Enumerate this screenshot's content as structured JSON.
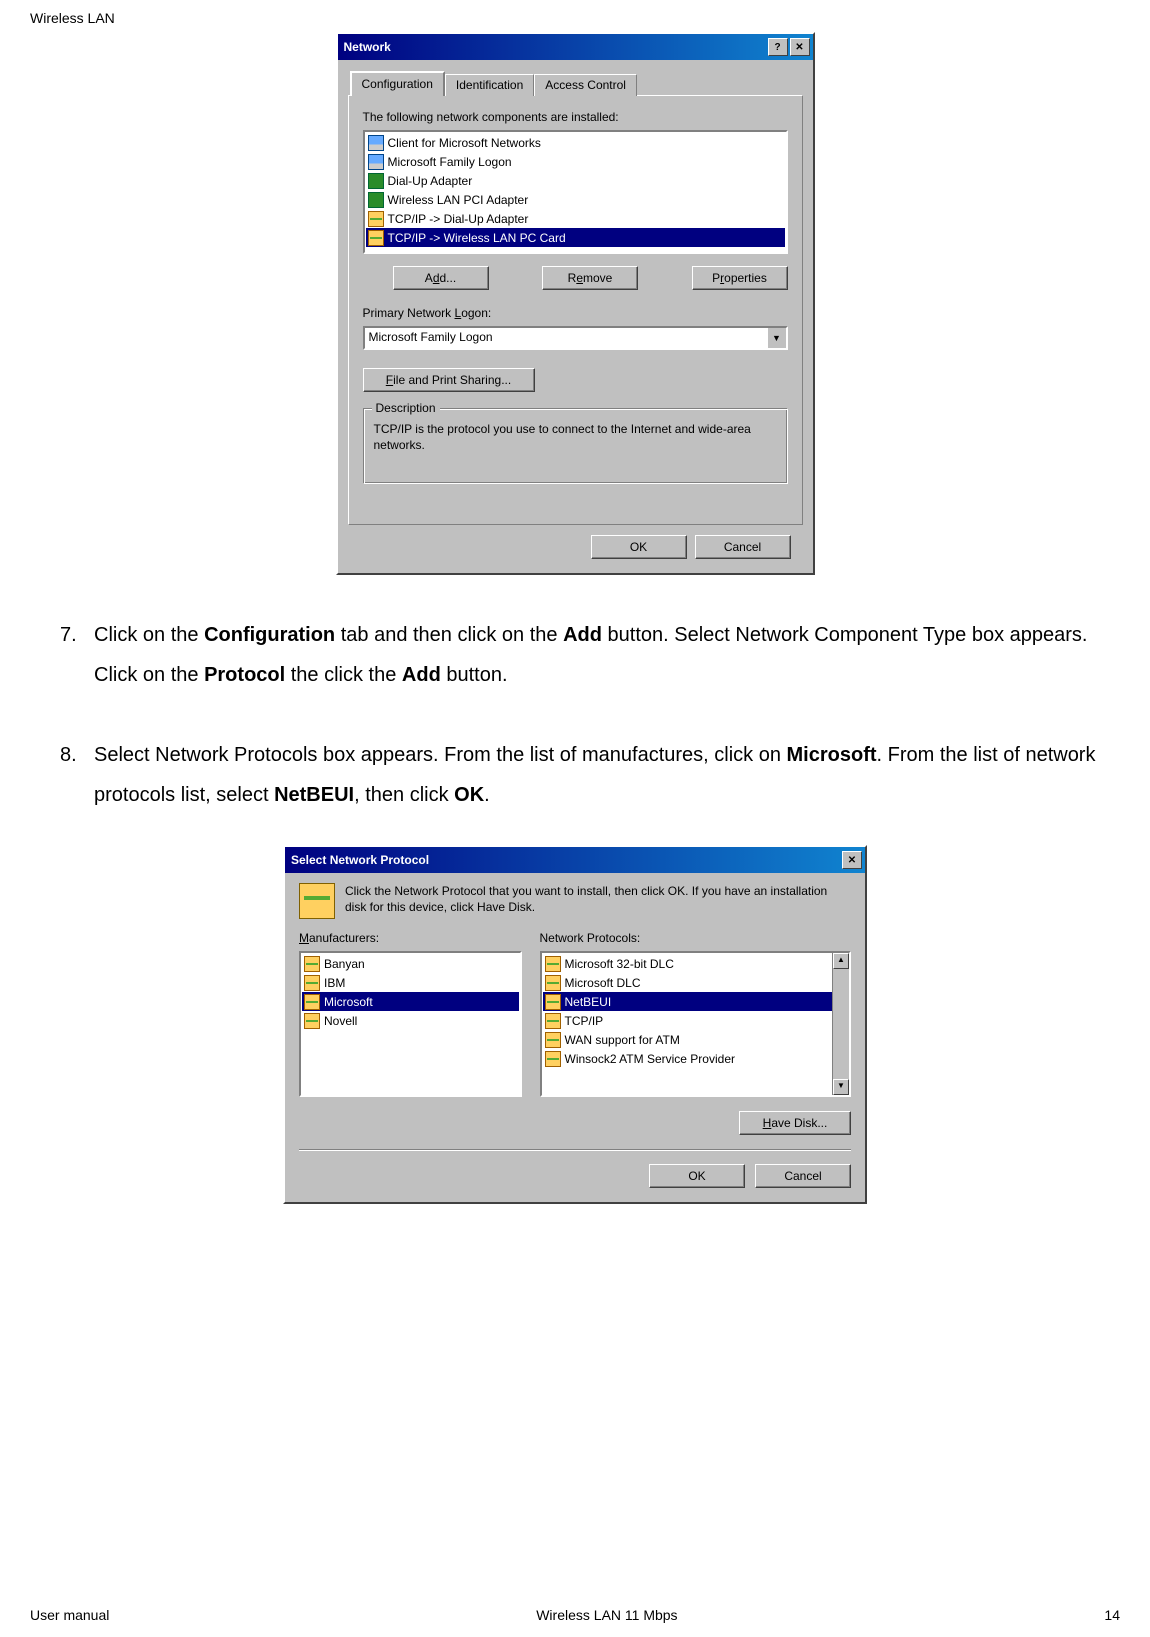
{
  "page_header": "Wireless LAN",
  "network_dialog": {
    "title": "Network",
    "help_btn": "?",
    "close_btn": "✕",
    "tabs": {
      "configuration": "Configuration",
      "identification": "Identification",
      "access_control": "Access Control"
    },
    "installed_label": "The following network components are installed:",
    "components": [
      "Client for Microsoft Networks",
      "Microsoft Family Logon",
      "Dial-Up Adapter",
      "Wireless LAN PCI Adapter",
      "TCP/IP -> Dial-Up Adapter",
      "TCP/IP -> Wireless LAN PC Card"
    ],
    "buttons": {
      "add_pre": "A",
      "add_u": "d",
      "add_post": "d...",
      "remove_pre": "R",
      "remove_u": "e",
      "remove_post": "move",
      "properties_pre": "P",
      "properties_u": "r",
      "properties_post": "operties"
    },
    "primary_logon_label_pre": "Primary Network ",
    "primary_logon_label_u": "L",
    "primary_logon_label_post": "ogon:",
    "primary_logon_value": "Microsoft Family Logon",
    "fps_pre": "",
    "fps_u": "F",
    "fps_post": "ile and Print Sharing...",
    "description_title": "Description",
    "description_text": "TCP/IP is the protocol you use to connect to the Internet and wide-area networks.",
    "ok": "OK",
    "cancel": "Cancel"
  },
  "step7_text_pre": "Click on the ",
  "step7_b1": "Configuration",
  "step7_text_mid1": " tab and then click on the ",
  "step7_b2": "Add",
  "step7_text_mid2": " button. Select Network Component Type box appears. Click on the ",
  "step7_b3": "Protocol",
  "step7_text_mid3": " the click the ",
  "step7_b4": "Add",
  "step7_text_end": " button.",
  "step8_text_pre": "Select Network Protocols box appears. From the list of manufactures, click on ",
  "step8_b1": "Microsoft",
  "step8_text_mid1": ". From the list of network protocols list, select ",
  "step8_b2": "NetBEUI",
  "step8_text_mid2": ", then click ",
  "step8_b3": "OK",
  "step8_text_end": ".",
  "select_proto_dialog": {
    "title": "Select Network Protocol",
    "close_btn": "✕",
    "instructions": "Click the Network Protocol that you want to install, then click OK. If you have an installation disk for this device, click Have Disk.",
    "manufacturers_label_u": "M",
    "manufacturers_label_post": "anufacturers:",
    "manufacturers": [
      "Banyan",
      "IBM",
      "Microsoft",
      "Novell"
    ],
    "protocols_label": "Network Protocols:",
    "protocols": [
      "Microsoft 32-bit DLC",
      "Microsoft DLC",
      "NetBEUI",
      "TCP/IP",
      "WAN support for ATM",
      "Winsock2 ATM Service Provider"
    ],
    "have_disk_u": "H",
    "have_disk_post": "ave Disk...",
    "ok": "OK",
    "cancel": "Cancel"
  },
  "footer": {
    "left": "User manual",
    "center": "Wireless LAN 11 Mbps",
    "right": "14"
  }
}
